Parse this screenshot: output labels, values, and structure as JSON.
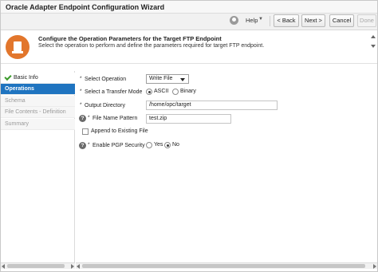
{
  "window": {
    "title": "Oracle Adapter Endpoint Configuration Wizard"
  },
  "toolbar": {
    "help_label": "Help",
    "back_label": "< Back",
    "next_label": "Next >",
    "cancel_label": "Cancel",
    "done_label": "Done"
  },
  "banner": {
    "title": "Configure the Operation Parameters for the Target FTP Endpoint",
    "description": "Select the operation to perform and define the parameters required for target FTP endpoint."
  },
  "nav": {
    "items": [
      {
        "label": "Basic Info",
        "state": "done"
      },
      {
        "label": "Operations",
        "state": "active"
      },
      {
        "label": "Schema",
        "state": "disabled"
      },
      {
        "label": "File Contents - Definition",
        "state": "disabled"
      },
      {
        "label": "Summary",
        "state": "disabled"
      }
    ]
  },
  "form": {
    "required_marker": "*",
    "help_marker": "?",
    "select_operation": {
      "label": "Select Operation",
      "value": "Write File"
    },
    "transfer_mode": {
      "label": "Select a Transfer Mode",
      "options": [
        "ASCII",
        "Binary"
      ],
      "selected": "ASCII"
    },
    "output_directory": {
      "label": "Output Directory",
      "value": "/home/opc/target"
    },
    "file_name_pattern": {
      "label": "File Name Pattern",
      "value": "test.zip"
    },
    "append": {
      "label": "Append to Existing File",
      "checked": false
    },
    "pgp": {
      "label": "Enable PGP Security",
      "options": [
        "Yes",
        "No"
      ],
      "selected": "No"
    }
  },
  "colors": {
    "accent": "#1f74c0",
    "banner_icon": "#e2762c",
    "check": "#3b9a2a"
  }
}
